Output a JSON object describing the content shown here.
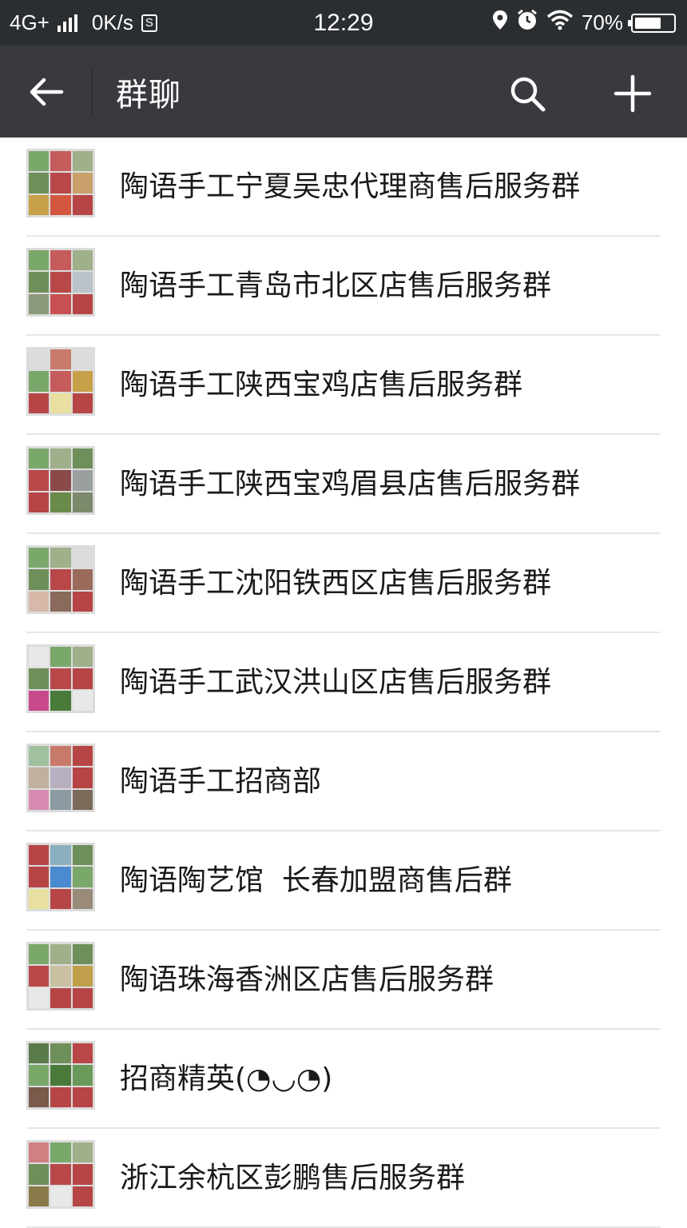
{
  "status_bar": {
    "network": "4G+",
    "speed": "0K/s",
    "sim_icon": "S",
    "time": "12:29",
    "battery": "70%",
    "battery_level": 0.7,
    "icons": [
      "signal-icon",
      "location-icon",
      "alarm-icon",
      "wifi-icon",
      "battery-icon"
    ]
  },
  "header": {
    "title": "群聊",
    "back_icon": "back-arrow-icon",
    "search_icon": "search-icon",
    "add_icon": "add-icon"
  },
  "groups": [
    {
      "name": "陶语手工宁夏吴忠代理商售后服务群",
      "avatar_colors": [
        "#7aa86a",
        "#c65b5b",
        "#9fb08a",
        "#6f8f5a",
        "#b84848",
        "#c9a06a",
        "#c8a04a",
        "#d3573f",
        "#b64545"
      ]
    },
    {
      "name": "陶语手工青岛市北区店售后服务群",
      "avatar_colors": [
        "#7aa86a",
        "#c65b5b",
        "#9fb08a",
        "#6f8f5a",
        "#b84848",
        "#b9c3c8",
        "#8a9a7a",
        "#c75050",
        "#b64545"
      ]
    },
    {
      "name": "陶语手工陕西宝鸡店售后服务群",
      "avatar_colors": [
        "#dcdcdc",
        "#c77a6a",
        "#dcdcdc",
        "#7aa86a",
        "#c65b5b",
        "#c8a04a",
        "#b64545",
        "#e8dfa0",
        "#b64545"
      ]
    },
    {
      "name": "陶语手工陕西宝鸡眉县店售后服务群",
      "avatar_colors": [
        "#7aa86a",
        "#9fb08a",
        "#6f8f5a",
        "#b84848",
        "#8a4a4a",
        "#9aa0a0",
        "#b64545",
        "#6a8a4a",
        "#7a8a6a"
      ]
    },
    {
      "name": "陶语手工沈阳铁西区店售后服务群",
      "avatar_colors": [
        "#7aa86a",
        "#9fb08a",
        "#dcdcdc",
        "#6f8f5a",
        "#b84848",
        "#9a6a5a",
        "#d8b8a8",
        "#8a6a5a",
        "#b64545"
      ]
    },
    {
      "name": "陶语手工武汉洪山区店售后服务群",
      "avatar_colors": [
        "#e8e8e8",
        "#7aa86a",
        "#9fb08a",
        "#6f8f5a",
        "#b84848",
        "#b64545",
        "#c84a8a",
        "#4a7a3a",
        "#e8e8e8"
      ]
    },
    {
      "name": "陶语手工招商部",
      "avatar_colors": [
        "#a0c0a0",
        "#c87a6a",
        "#b64545",
        "#c0b0a0",
        "#b8b0c0",
        "#b64545",
        "#d88ab0",
        "#8a9aa0",
        "#7a6a5a"
      ]
    },
    {
      "name": "陶语陶艺馆  长春加盟商售后群",
      "avatar_colors": [
        "#b64545",
        "#8ab0c0",
        "#6f8f5a",
        "#b64545",
        "#4a8ad0",
        "#7aa86a",
        "#e8e0a0",
        "#b64545",
        "#9a8a7a"
      ]
    },
    {
      "name": "陶语珠海香洲区店售后服务群",
      "avatar_colors": [
        "#7aa86a",
        "#9fb08a",
        "#6f8f5a",
        "#b84848",
        "#c8c0a0",
        "#c0a04a",
        "#e8e8e8",
        "#b64545",
        "#b64545"
      ]
    },
    {
      "name": "招商精英(◔◡◔)",
      "avatar_colors": [
        "#5a7a4a",
        "#6f8f5a",
        "#b84848",
        "#7aa86a",
        "#4a7a3a",
        "#6a9a5a",
        "#7a5a4a",
        "#b64545",
        "#b64545"
      ]
    },
    {
      "name": "浙江余杭区彭鹏售后服务群",
      "avatar_colors": [
        "#d08080",
        "#7aa86a",
        "#9fb08a",
        "#6f8f5a",
        "#b84848",
        "#b64545",
        "#8a7a4a",
        "#e8e8e8",
        "#b64545"
      ]
    }
  ]
}
